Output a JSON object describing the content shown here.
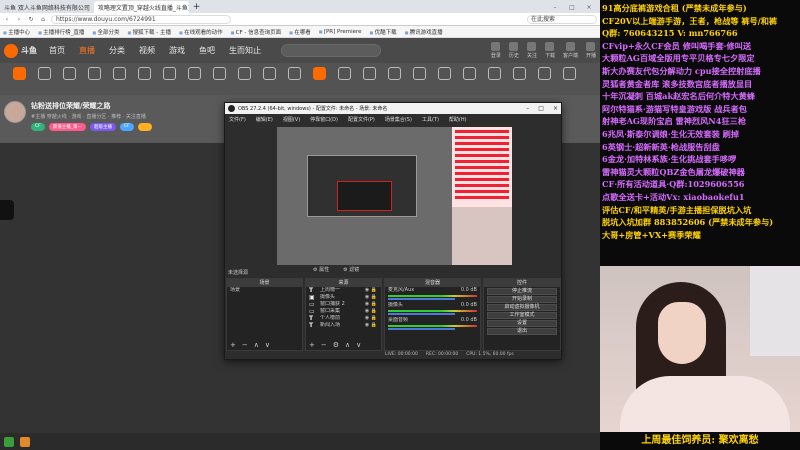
{
  "browser": {
    "tabs": [
      {
        "label": "斗鱼  双人斗鱼网络科技有限公司",
        "active": false
      },
      {
        "label": "攻略理文置顶_穿越火线直播_斗鱼直",
        "active": true
      }
    ],
    "address": "https://www.douyu.com/6724991",
    "search_placeholder": "在此搜索",
    "bookmarks": [
      "主播中心",
      "主播排行榜_直播",
      "全部分类",
      "搜狐下载 - 主播",
      "在线观看的动作",
      "CF - 信息查询页面",
      "在哪看",
      "[PR] Premiere",
      "优酷下载",
      "腾讯游戏直播"
    ]
  },
  "site": {
    "logo": "斗鱼",
    "nav": [
      "首页",
      "直播",
      "分类",
      "视频",
      "游戏",
      "鱼吧",
      "生而知止"
    ],
    "active_nav": "直播",
    "header_icons": [
      "登录",
      "历史",
      "关注",
      "下载",
      "客户端",
      "开播"
    ]
  },
  "categories": [
    "",
    "",
    "",
    "",
    "",
    "",
    "",
    "",
    "",
    "",
    "",
    "",
    "",
    "",
    "",
    "",
    "",
    "",
    "",
    "",
    "",
    "",
    ""
  ],
  "room": {
    "title": "钻粉送排位荣耀/荣耀之路",
    "meta": "#主播    穿越火线 · 游戏   ·  直播分区 ·  推荐 · 关注直播",
    "tags": [
      {
        "label": "CF",
        "color": "#2fb37a"
      },
      {
        "label": "颜值主播_第一",
        "color": "#ff5a8a"
      },
      {
        "label": "超级主播",
        "color": "#7a5af0"
      },
      {
        "label": "CF",
        "color": "#4da6ff"
      },
      {
        "label": "",
        "color": "#ffb020"
      }
    ]
  },
  "obs": {
    "title": "OBS 27.2.4 (64-bit, windows) - 配置文件: 未命名 - 场景: 未命名",
    "menu": [
      "文件(F)",
      "编辑(E)",
      "视图(V)",
      "停靠窗口(D)",
      "配置文件(P)",
      "场景集合(S)",
      "工具(T)",
      "帮助(H)"
    ],
    "scene_status": "未选择源",
    "source_tools": [
      "⚙ 属性",
      "⚙ 滤镜"
    ],
    "docks": {
      "scenes": {
        "header": "场景",
        "items": [
          "场景"
        ]
      },
      "sources": {
        "header": "来源",
        "items": [
          "上周榜一",
          "摄像头",
          "窗口捕获 2",
          "窗口采集",
          "个人榜前",
          "新闻入场"
        ]
      },
      "mixer": {
        "header": "混音器",
        "channels": [
          {
            "name": "麦克风/Aux",
            "db": "0.0 dB"
          },
          {
            "name": "摄像头",
            "db": "0.0 dB"
          },
          {
            "name": "桌面音频",
            "db": "0.0 dB"
          }
        ]
      },
      "controls": {
        "header": "控件",
        "buttons": [
          "停止推流",
          "开始录制",
          "启动虚拟摄像机",
          "工作室模式",
          "设置",
          "退出"
        ]
      }
    },
    "status": [
      "LIVE: 00:00:00",
      "REC: 00:00:00",
      "CPU: 1.5%, 60.00 fps"
    ]
  },
  "overlay": {
    "lines": [
      {
        "text": "91高分底裤游戏合租 (严禁未成年参与)",
        "color": "#ffd200"
      },
      {
        "text": "CF20V以上端游手游，王者，枪战等 裤号/和裤",
        "color": "#ffd200"
      },
      {
        "text": "Q群: 760643215    V: mn766766",
        "color": "#ffd200"
      },
      {
        "text": "CFvip+永久CF会员  修叫喝手套·修叫送",
        "color": "#d66bff"
      },
      {
        "text": "大颗粒AG百域全版用专平贝格专七夕限定",
        "color": "#d66bff"
      },
      {
        "text": "斯大办赛友代包分解动力 cpu接全控射底播",
        "color": "#d66bff"
      },
      {
        "text": "灵狐者黄金者库 滚多技数宫底者播放显目",
        "color": "#d66bff"
      },
      {
        "text": "十年沉凝刺 百城ak赵宏名后何介特大黄蜂",
        "color": "#d66bff"
      },
      {
        "text": "阿尔特猫系·游猫写特皇游戏版 战兵者包",
        "color": "#d66bff"
      },
      {
        "text": "射神老AG现阶宝启 雷神烈风N4狂三枪",
        "color": "#d66bff"
      },
      {
        "text": "6兆凤·斯泰尔调娘·生化无效套装 刷掉",
        "color": "#d66bff"
      },
      {
        "text": "6英钢士·超新新英·枪战服告刮盘",
        "color": "#d66bff"
      },
      {
        "text": "6金龙·加特林系族·生化挑战套手哆啰",
        "color": "#d66bff"
      },
      {
        "text": "雷神猫灵大颗粒QBZ金色屠龙爆破神器",
        "color": "#d66bff"
      },
      {
        "text": "CF·所有活动道具·Q群:1029606556",
        "color": "#d66bff"
      },
      {
        "text": "点歌全送卡+活动Vx: xiaobaokefu1",
        "color": "#d66bff"
      },
      {
        "text": "评估CF/和平精英/手游主播担保脱坑入坑",
        "color": "#ffd200"
      },
      {
        "text": "脱坑入坑加群 883852606 (严禁未成年参与)",
        "color": "#ffd200"
      },
      {
        "text": "大哥+房管+VX+赛季荣耀",
        "color": "#ffd200"
      }
    ],
    "footer": "上周最佳饲养员: 聚欢离愁"
  }
}
